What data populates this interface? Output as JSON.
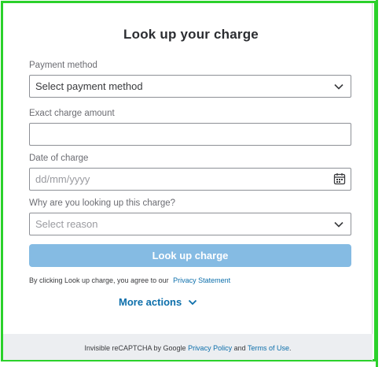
{
  "title": "Look up your charge",
  "payment_method": {
    "label": "Payment method",
    "value": "Select payment method"
  },
  "charge_amount": {
    "label": "Exact charge amount",
    "value": ""
  },
  "date_of_charge": {
    "label": "Date of charge",
    "placeholder": "dd/mm/yyyy"
  },
  "reason": {
    "label": "Why are you looking up this charge?",
    "placeholder": "Select reason"
  },
  "submit_label": "Look up charge",
  "consent": {
    "text": "By clicking Look up charge, you agree to our",
    "link": "Privacy Statement"
  },
  "more_actions": "More actions",
  "footer": {
    "prefix": "Invisible reCAPTCHA by Google",
    "privacy_link": "Privacy Policy",
    "and": "and",
    "terms_link": "Terms of Use",
    "suffix": "."
  },
  "colors": {
    "border_accent": "#2bd12b",
    "button": "#85bbe3",
    "link": "#0d6fab"
  },
  "icons": {
    "dropdown": "chevron-down-icon",
    "date": "calendar-icon"
  }
}
